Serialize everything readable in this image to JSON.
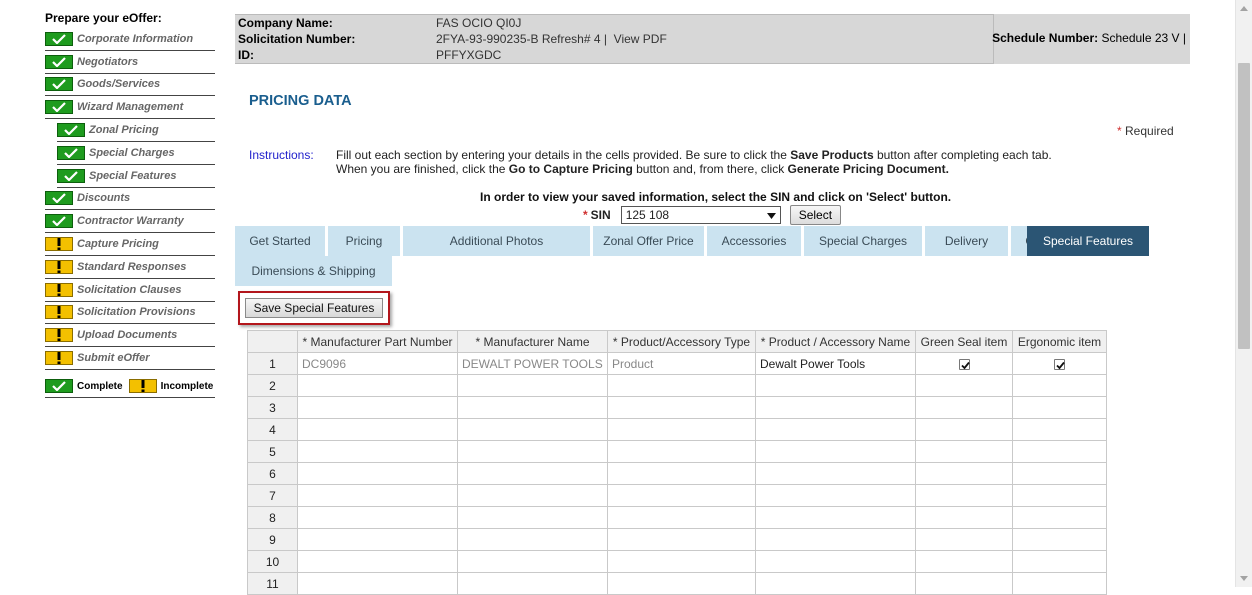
{
  "sidebar": {
    "title": "Prepare your eOffer:",
    "items": [
      {
        "label": "Corporate Information",
        "status": "complete"
      },
      {
        "label": "Negotiators",
        "status": "complete"
      },
      {
        "label": "Goods/Services",
        "status": "complete"
      },
      {
        "label": "Wizard Management",
        "status": "complete"
      },
      {
        "label": "Zonal Pricing",
        "status": "complete"
      },
      {
        "label": "Special Charges",
        "status": "complete"
      },
      {
        "label": "Special Features",
        "status": "complete"
      },
      {
        "label": "Discounts",
        "status": "complete"
      },
      {
        "label": "Contractor Warranty",
        "status": "complete"
      },
      {
        "label": "Capture Pricing",
        "status": "incomplete"
      },
      {
        "label": "Standard Responses",
        "status": "incomplete"
      },
      {
        "label": "Solicitation Clauses",
        "status": "incomplete"
      },
      {
        "label": "Solicitation Provisions",
        "status": "incomplete"
      },
      {
        "label": "Upload Documents",
        "status": "incomplete"
      },
      {
        "label": "Submit eOffer",
        "status": "incomplete"
      }
    ],
    "legend": {
      "complete": "Complete",
      "incomplete": "Incomplete"
    }
  },
  "header": {
    "company_label": "Company Name:",
    "company_value": "FAS OCIO QI0J",
    "solicitation_label": "Solicitation Number:",
    "solicitation_value": "2FYA-93-990235-B Refresh# 4 |",
    "view_pdf": "View PDF",
    "id_label": "ID:",
    "id_value": "PFFYXGDC",
    "schedule_label": "Schedule Number:",
    "schedule_value": "Schedule 23 V |"
  },
  "page": {
    "title": "PRICING DATA",
    "required_star": "*",
    "required": "Required",
    "instructions_label": "Instructions:",
    "instr_l1_a": "Fill out each section by entering your details in the cells provided. Be sure to click the ",
    "instr_l1_b": "Save Products",
    "instr_l1_c": " button after completing each tab.",
    "instr_l2_a": "When you are finished, click the ",
    "instr_l2_b": "Go to Capture Pricing",
    "instr_l2_c": " button and, from there, click ",
    "instr_l2_d": "Generate Pricing Document.",
    "sin_prompt": "In order to view your saved information, select the SIN and click on 'Select' button.",
    "sin_star": "*",
    "sin_label": "SIN",
    "sin_value": "125 108",
    "select_button": "Select",
    "save_button": "Save Special Features"
  },
  "tabs": [
    {
      "label": "Get Started",
      "active": false
    },
    {
      "label": "Pricing",
      "active": false
    },
    {
      "label": "Additional Photos",
      "active": false
    },
    {
      "label": "Zonal Offer Price",
      "active": false
    },
    {
      "label": "Accessories",
      "active": false
    },
    {
      "label": "Special Charges",
      "active": false
    },
    {
      "label": "Delivery",
      "active": false
    },
    {
      "label": "Options",
      "active": false
    },
    {
      "label": "Special Features",
      "active": true
    },
    {
      "label": "Dimensions & Shipping",
      "active": false
    }
  ],
  "grid": {
    "columns": [
      "* Manufacturer Part Number",
      "* Manufacturer Name",
      "* Product/Accessory Type",
      "* Product / Accessory Name",
      "Green Seal item",
      "Ergonomic item"
    ],
    "rows": [
      {
        "n": "1",
        "part": "DC9096",
        "mfr": "DEWALT POWER TOOLS",
        "type": "Product",
        "name": "Dewalt Power Tools",
        "green": true,
        "ergo": true
      },
      {
        "n": "2"
      },
      {
        "n": "3"
      },
      {
        "n": "4"
      },
      {
        "n": "5"
      },
      {
        "n": "6"
      },
      {
        "n": "7"
      },
      {
        "n": "8"
      },
      {
        "n": "9"
      },
      {
        "n": "10"
      },
      {
        "n": "11"
      }
    ]
  },
  "colors": {
    "tab": "#cbe3f0",
    "tab_active": "#2b5574",
    "title": "#1a5e8e",
    "complete": "#1e9b1e",
    "incomplete": "#f3c000"
  }
}
